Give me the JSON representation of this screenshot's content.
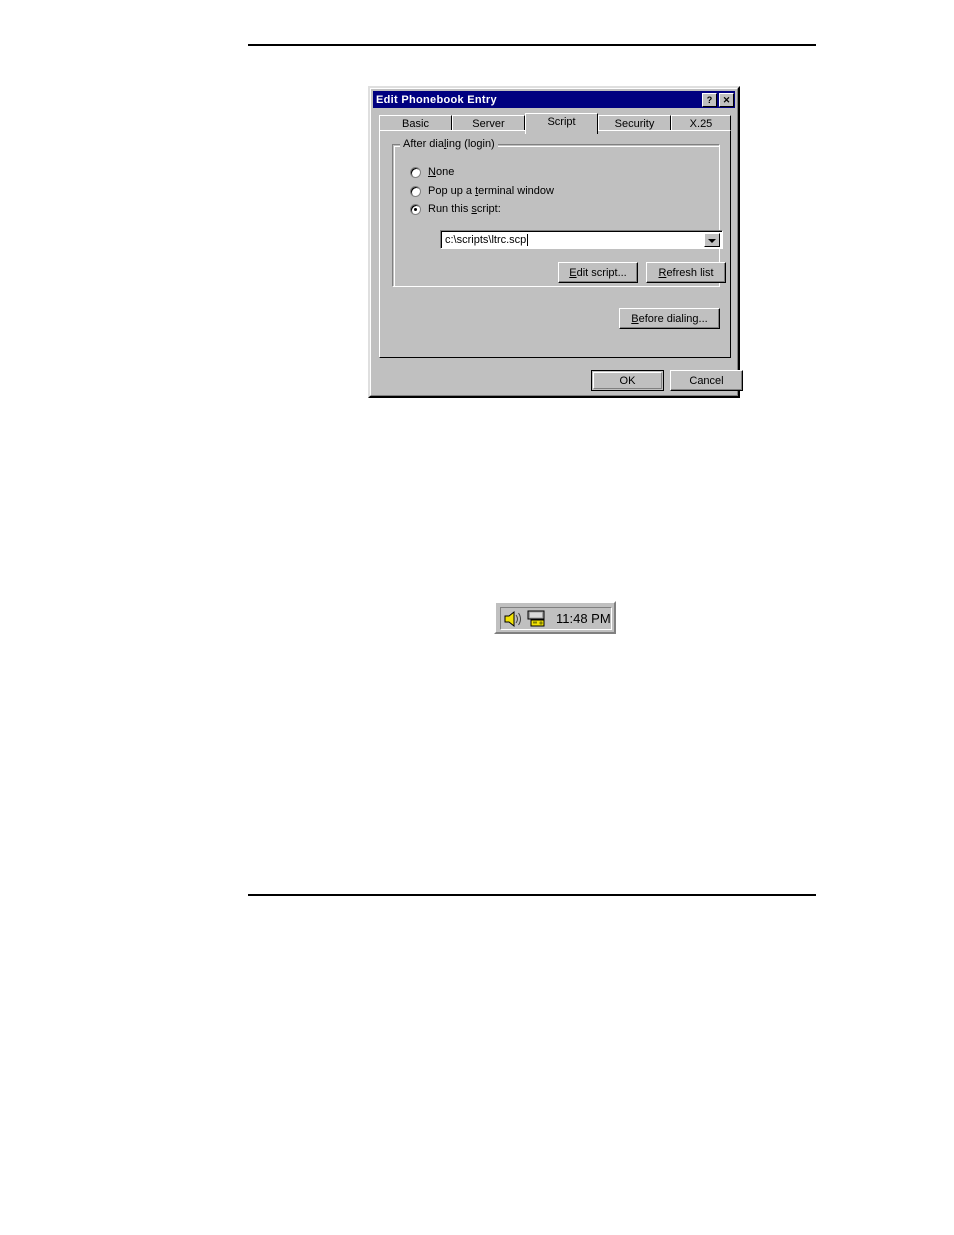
{
  "page": {
    "rules": [
      "top-rule",
      "bottom-rule"
    ]
  },
  "dialog": {
    "title": "Edit Phonebook Entry",
    "title_buttons": [
      {
        "name": "help-button",
        "label": "?"
      },
      {
        "name": "close-button",
        "label": "✕"
      }
    ],
    "tabs": [
      {
        "label": "Basic",
        "selected": false
      },
      {
        "label": "Server",
        "selected": false
      },
      {
        "label": "Script",
        "selected": true
      },
      {
        "label": "Security",
        "selected": false
      },
      {
        "label": "X.25",
        "selected": false
      }
    ],
    "groupbox": {
      "title_pre": "After dia",
      "title_accel": "l",
      "title_post": "ing (login)",
      "title_full": "After dialing (login)"
    },
    "radios": [
      {
        "label_pre": "",
        "accel": "N",
        "label_post": "one",
        "full": "None",
        "selected": false
      },
      {
        "label_pre": "Pop up a ",
        "accel": "t",
        "label_post": "erminal window",
        "full": "Pop up a terminal window",
        "selected": false
      },
      {
        "label_pre": "Run this ",
        "accel": "s",
        "label_post": "cript:",
        "full": "Run this script:",
        "selected": true
      }
    ],
    "script_combo": {
      "value": "c:\\scripts\\ltrc.scp",
      "placeholder": "",
      "has_caret": true,
      "arrow": "chevron-down-icon"
    },
    "buttons": {
      "edit_script": {
        "pre": "",
        "accel": "E",
        "post": "dit script...",
        "full": "Edit script..."
      },
      "refresh_list": {
        "pre": "",
        "accel": "R",
        "post": "efresh list",
        "full": "Refresh list"
      },
      "before_dialing": {
        "pre": "",
        "accel": "B",
        "post": "efore dialing...",
        "full": "Before dialing..."
      },
      "ok": {
        "label": "OK",
        "default": true
      },
      "cancel": {
        "label": "Cancel",
        "default": false
      }
    }
  },
  "tray": {
    "icons": [
      {
        "name": "speaker-icon",
        "color": "#f2e205"
      },
      {
        "name": "dialup-networking-icon",
        "color": "#f2e205"
      }
    ],
    "time": "11:48 PM"
  },
  "colors": {
    "face": "#c0c0c0",
    "titlebar": "#000080",
    "titlebar_text": "#ffffff",
    "shadow": "#808080",
    "light": "#ffffff",
    "dark": "#000000",
    "field": "#ffffff",
    "icon_yellow": "#f2e205"
  }
}
